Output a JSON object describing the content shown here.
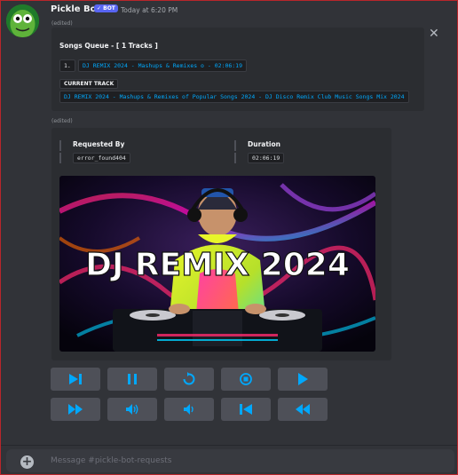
{
  "message": {
    "author": "Pickle Bot",
    "badge": "✓ BOT",
    "timestamp": "Today at 6:20 PM",
    "edited_label": "(edited)",
    "edited_label_2": "(edited)"
  },
  "queue_embed": {
    "title": "Songs Queue  -  [ 1 Tracks ]",
    "items": [
      {
        "index": "1.",
        "title": "DJ REMIX 2024 - Mashups & Remixes o - 02:06:19"
      }
    ],
    "current_label": "CURRENT TRACK",
    "current_track": "DJ REMIX 2024 - Mashups & Remixes of Popular Songs 2024 - DJ Disco Remix Club Music Songs Mix 2024",
    "close_icon": "✕"
  },
  "now_playing": {
    "fields": [
      {
        "name": "Requested By",
        "value": "error_found404"
      },
      {
        "name": "Duration",
        "value": "02:06:19"
      }
    ],
    "thumbnail_text": "DJ REMIX 2024"
  },
  "controls": {
    "row1": [
      "skip-next-icon",
      "pause-icon",
      "loop-icon",
      "stop-icon",
      "play-icon"
    ],
    "row2": [
      "fast-forward-icon",
      "volume-up-icon",
      "volume-down-icon",
      "skip-previous-icon",
      "rewind-icon"
    ],
    "accent": "#00a8fc"
  },
  "composer": {
    "placeholder": "Message #pickle-bot-requests",
    "plus_icon": "+"
  },
  "colors": {
    "background": "#313338",
    "embed": "#2b2d31",
    "button": "#4e5058",
    "link": "#00a8fc",
    "bot_badge": "#5865f2"
  }
}
